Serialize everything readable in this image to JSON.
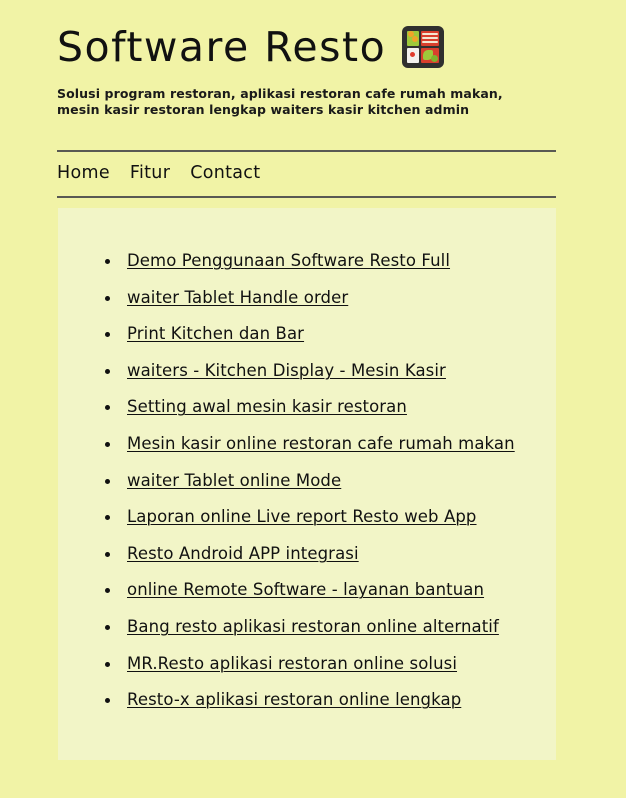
{
  "site": {
    "title": "Software Resto",
    "title_icon": "bento-box-icon",
    "tagline": "Solusi program restoran, aplikasi restoran cafe rumah makan, mesin kasir restoran lengkap waiters kasir kitchen admin"
  },
  "nav": {
    "items": [
      {
        "label": "Home"
      },
      {
        "label": "Fitur"
      },
      {
        "label": "Contact"
      }
    ]
  },
  "content": {
    "links": [
      {
        "label": "Demo Penggunaan Software Resto Full"
      },
      {
        "label": "waiter Tablet Handle order"
      },
      {
        "label": "Print Kitchen dan Bar"
      },
      {
        "label": "waiters - Kitchen Display - Mesin Kasir"
      },
      {
        "label": "Setting awal mesin kasir restoran"
      },
      {
        "label": "Mesin kasir online restoran cafe rumah makan"
      },
      {
        "label": "waiter Tablet online Mode"
      },
      {
        "label": "Laporan online Live report Resto web App"
      },
      {
        "label": "Resto Android APP integrasi"
      },
      {
        "label": "online Remote Software - layanan bantuan"
      },
      {
        "label": "Bang resto aplikasi restoran online alternatif"
      },
      {
        "label": "MR.Resto aplikasi restoran online solusi"
      },
      {
        "label": "Resto-x aplikasi restoran online lengkap"
      }
    ]
  },
  "colors": {
    "page_background": "#f1f3a6",
    "panel_background": "#f2f5c7",
    "text": "#111111",
    "rule": "#595953"
  }
}
